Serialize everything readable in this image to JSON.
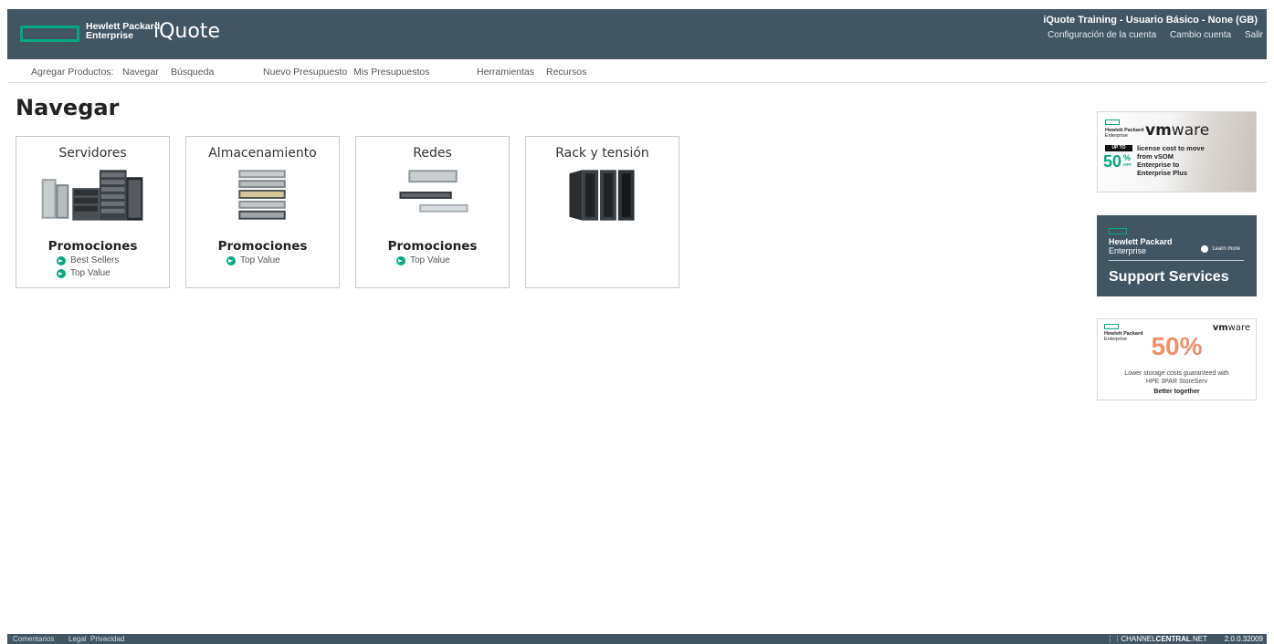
{
  "header": {
    "logo_line1": "Hewlett Packard",
    "logo_line2": "Enterprise",
    "app_name": "iQuote",
    "user_info": "iQuote Training - Usuario Básico - None (GB)",
    "links": [
      "Configuración de la cuenta",
      "Cambio cuenta",
      "Salir"
    ]
  },
  "nav": {
    "items": [
      "Agregar Productos:",
      "Navegar",
      "Búsqueda",
      "Nuevo Presupuesto",
      "Mis Presupuestos",
      "Herramientas",
      "Recursos"
    ]
  },
  "page_title": "Navegar",
  "cards": [
    {
      "title": "Servidores",
      "promo_title": "Promociones",
      "links": [
        "Best Sellers",
        "Top Value"
      ]
    },
    {
      "title": "Almacenamiento",
      "promo_title": "Promociones",
      "links": [
        "Top Value"
      ]
    },
    {
      "title": "Redes",
      "promo_title": "Promociones",
      "links": [
        "Top Value"
      ]
    },
    {
      "title": "Rack y tensión",
      "promo_title": "",
      "links": []
    }
  ],
  "ads": {
    "ad1": {
      "logo_line1": "Hewlett Packard",
      "logo_line2": "Enterprise",
      "vmware_bold": "vm",
      "vmware_rest": "ware",
      "upto": "UP TO",
      "percent": "50",
      "percent_sign": "%",
      "off": "OFF",
      "text_lines": [
        "license cost to move",
        "from vSOM",
        "Enterprise to",
        "Enterprise Plus"
      ]
    },
    "ad2": {
      "logo_line1": "Hewlett Packard",
      "logo_line2": "Enterprise",
      "learn_more": "Learn more",
      "title": "Support Services"
    },
    "ad3": {
      "logo_line1": "Hewlett Packard",
      "logo_line2": "Enterprise",
      "vmware_bold": "vm",
      "vmware_rest": "ware",
      "percent": "50%",
      "line1": "Lower storage costs guaranteed with",
      "line2": "HPE 3PAR StoreServ",
      "tagline": "Better together"
    }
  },
  "footer": {
    "links": [
      "Comentarios",
      "Legal",
      "Privacidad"
    ],
    "brand_prefix": "CHANNEL",
    "brand_bold": "CENTRAL",
    "brand_suffix": ".NET",
    "version": "2.0.0.32009"
  },
  "colors": {
    "header_bg": "#425563",
    "accent_green": "#01a982",
    "promo_orange": "#f0906a"
  }
}
